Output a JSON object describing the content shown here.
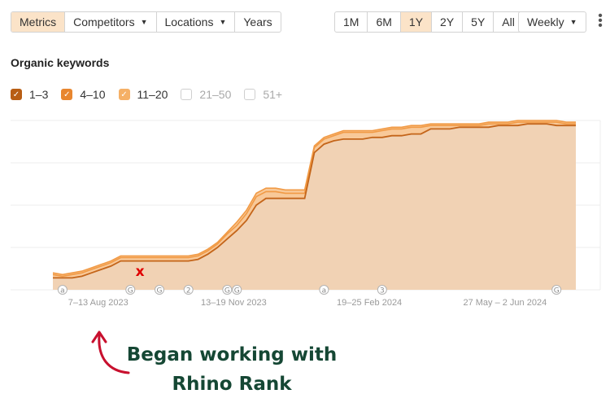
{
  "toolbar": {
    "tabs": [
      {
        "label": "Metrics",
        "active": true,
        "dropdown": false
      },
      {
        "label": "Competitors",
        "active": false,
        "dropdown": true
      },
      {
        "label": "Locations",
        "active": false,
        "dropdown": true
      },
      {
        "label": "Years",
        "active": false,
        "dropdown": false
      }
    ],
    "ranges": [
      {
        "label": "1M",
        "active": false
      },
      {
        "label": "6M",
        "active": false
      },
      {
        "label": "1Y",
        "active": true
      },
      {
        "label": "2Y",
        "active": false
      },
      {
        "label": "5Y",
        "active": false
      },
      {
        "label": "All",
        "active": false
      }
    ],
    "interval": "Weekly",
    "more_icon": "vertical-ellipsis-icon"
  },
  "section_title": "Organic keywords",
  "legend": [
    {
      "label": "1–3",
      "checked": true,
      "color": "#b85e14"
    },
    {
      "label": "4–10",
      "checked": true,
      "color": "#e8862f"
    },
    {
      "label": "11–20",
      "checked": true,
      "color": "#f5b066"
    },
    {
      "label": "21–50",
      "checked": false,
      "color": "#cfcfcf"
    },
    {
      "label": "51+",
      "checked": false,
      "color": "#cfcfcf"
    }
  ],
  "colors": {
    "area_fill": "#f1d2b4",
    "band_fill": "#f5b777",
    "line_top": "#f19a45",
    "line_bottom": "#c4651a",
    "grid": "#ececec",
    "marker": "#e00000",
    "note_text": "#154734",
    "arrow": "#c8102e"
  },
  "chart_data": {
    "type": "area",
    "x_tick_labels": [
      "7–13 Aug 2023",
      "13–19 Nov 2023",
      "19–25 Feb 2024",
      "27 May – 2 Jun 2024"
    ],
    "x_tick_index": [
      3,
      17,
      31,
      45
    ],
    "ylim": [
      0,
      100
    ],
    "grid": true,
    "series": [
      {
        "values": [
          7,
          7,
          7,
          8,
          10,
          12,
          14,
          17,
          17,
          17,
          17,
          17,
          17,
          17,
          17,
          18,
          21,
          25,
          30,
          35,
          41,
          50,
          54,
          54,
          54,
          54,
          54,
          81,
          86,
          88,
          89,
          89,
          89,
          90,
          90,
          91,
          91,
          92,
          92,
          95,
          95,
          95,
          96,
          96,
          96,
          96,
          97,
          97,
          97,
          98,
          98,
          98,
          97,
          97,
          97
        ]
      },
      {
        "values": [
          9,
          8,
          9,
          10,
          12,
          14,
          16,
          19,
          19,
          19,
          19,
          19,
          19,
          19,
          19,
          20,
          23,
          27,
          33,
          38,
          45,
          55,
          58,
          58,
          57,
          57,
          57,
          84,
          89,
          91,
          93,
          93,
          93,
          93,
          94,
          95,
          95,
          96,
          96,
          97,
          97,
          97,
          97,
          97,
          97,
          98,
          98,
          98,
          99,
          99,
          99,
          99,
          99,
          98,
          98
        ]
      },
      {
        "values": [
          10,
          9,
          10,
          11,
          13,
          15,
          17,
          20,
          20,
          20,
          20,
          20,
          20,
          20,
          20,
          21,
          24,
          28,
          34,
          40,
          47,
          57,
          60,
          60,
          59,
          59,
          59,
          85,
          90,
          92,
          94,
          94,
          94,
          94,
          95,
          96,
          96,
          97,
          97,
          98,
          98,
          98,
          98,
          98,
          98,
          99,
          99,
          99,
          100,
          100,
          100,
          100,
          100,
          99,
          99
        ]
      }
    ],
    "event_markers": [
      {
        "index": 1,
        "glyph": "a"
      },
      {
        "index": 8,
        "glyph": "G"
      },
      {
        "index": 11,
        "glyph": "G"
      },
      {
        "index": 14,
        "glyph": "2"
      },
      {
        "index": 18,
        "glyph": "G"
      },
      {
        "index": 19,
        "glyph": "G"
      },
      {
        "index": 28,
        "glyph": "a"
      },
      {
        "index": 34,
        "glyph": "3"
      },
      {
        "index": 52,
        "glyph": "G"
      }
    ],
    "annotation_marker": {
      "index": 9,
      "value": 11,
      "glyph": "x"
    }
  },
  "note": {
    "line1": "Began working with",
    "line2": "Rhino Rank"
  }
}
